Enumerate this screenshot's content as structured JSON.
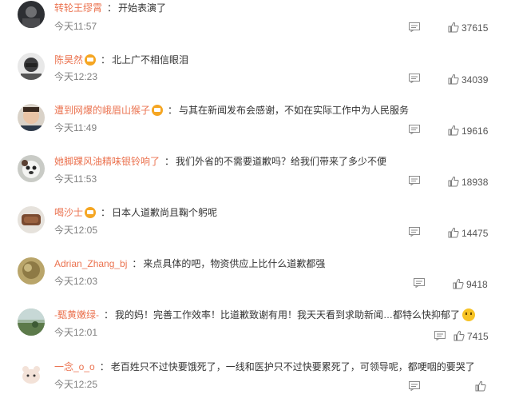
{
  "comments": [
    {
      "user": "转轮王缪霄",
      "verified": false,
      "text": "开始表演了",
      "time": "今天11:57",
      "likes": "37615"
    },
    {
      "user": "陈昊然",
      "verified": true,
      "text": "北上广不相信眼泪",
      "time": "今天12:23",
      "likes": "34039"
    },
    {
      "user": "遭到网爆的峨眉山猴子",
      "verified": true,
      "text": "与其在新闻发布会感谢，不如在实际工作中为人民服务",
      "time": "今天11:49",
      "likes": "19616"
    },
    {
      "user": "她脚踝风油精味银铃响了",
      "verified": false,
      "text": "我们外省的不需要道歉吗？给我们带来了多少不便",
      "time": "今天11:53",
      "likes": "18938"
    },
    {
      "user": "喝沙士",
      "verified": true,
      "text": "日本人道歉尚且鞠个躬呢",
      "time": "今天12:05",
      "likes": "14475"
    },
    {
      "user": "Adrian_Zhang_bj",
      "verified": false,
      "text": "来点具体的吧，物资供应上比什么道歉都强",
      "time": "今天12:03",
      "likes": "9418"
    },
    {
      "user": "-甄黄嫩绿-",
      "verified": false,
      "text": "我的妈！完善工作效率！比道歉致谢有用！我天天看到求助新闻…都特么快抑郁了",
      "time": "今天12:01",
      "likes": "7415",
      "emoji": "thinking-emoji"
    },
    {
      "user": "一念_o_o",
      "verified": false,
      "text": "老百姓只不过快要饿死了，一线和医护只不过快要累死了，可领导呢，都哽咽的要哭了",
      "time": "今天12:25",
      "likes": ""
    }
  ]
}
